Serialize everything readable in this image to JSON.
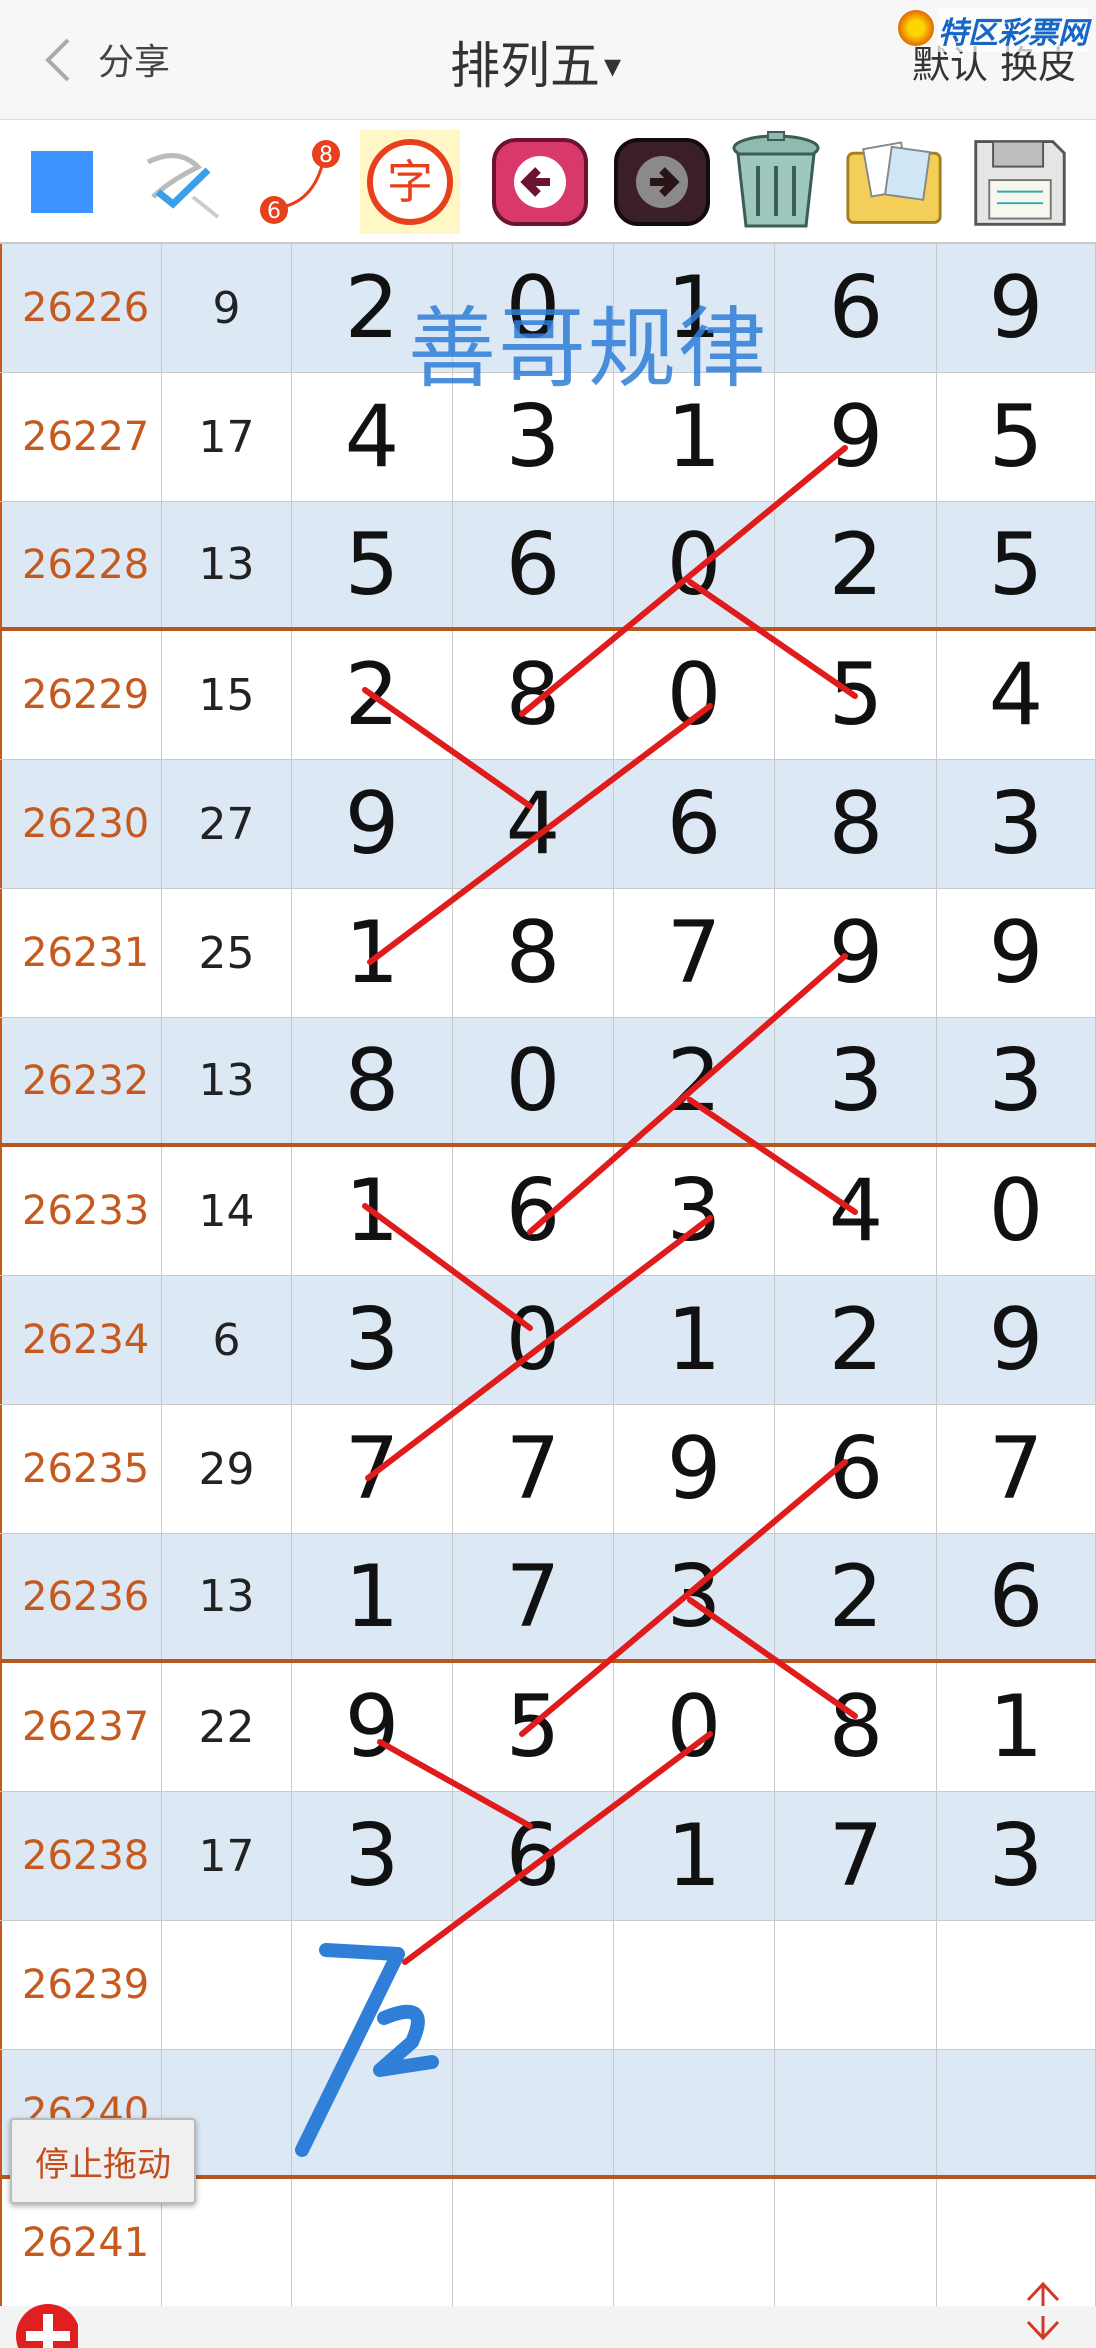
{
  "header": {
    "back_label": "分享",
    "title": "排列五",
    "title_caret": "▾",
    "right_label": "默认 换皮",
    "logo_text": "特区彩票网"
  },
  "toolbar": {
    "tools": [
      "color-square",
      "pen-check",
      "counter-6-8",
      "char-tool",
      "undo",
      "redo",
      "trash",
      "photos",
      "save"
    ],
    "char_label": "字",
    "counter_top": "8",
    "counter_bottom": "6",
    "accent": "#3d93ff"
  },
  "watermark": "善哥规律",
  "rows": [
    {
      "id": "26226",
      "sum": "9",
      "d": [
        "2",
        "0",
        "1",
        "6",
        "9"
      ]
    },
    {
      "id": "26227",
      "sum": "17",
      "d": [
        "4",
        "3",
        "1",
        "9",
        "5"
      ]
    },
    {
      "id": "26228",
      "sum": "13",
      "d": [
        "5",
        "6",
        "0",
        "2",
        "5"
      ]
    },
    {
      "id": "26229",
      "sum": "15",
      "d": [
        "2",
        "8",
        "0",
        "5",
        "4"
      ]
    },
    {
      "id": "26230",
      "sum": "27",
      "d": [
        "9",
        "4",
        "6",
        "8",
        "3"
      ]
    },
    {
      "id": "26231",
      "sum": "25",
      "d": [
        "1",
        "8",
        "7",
        "9",
        "9"
      ]
    },
    {
      "id": "26232",
      "sum": "13",
      "d": [
        "8",
        "0",
        "2",
        "3",
        "3"
      ]
    },
    {
      "id": "26233",
      "sum": "14",
      "d": [
        "1",
        "6",
        "3",
        "4",
        "0"
      ]
    },
    {
      "id": "26234",
      "sum": "6",
      "d": [
        "3",
        "0",
        "1",
        "2",
        "9"
      ]
    },
    {
      "id": "26235",
      "sum": "29",
      "d": [
        "7",
        "7",
        "9",
        "6",
        "7"
      ]
    },
    {
      "id": "26236",
      "sum": "13",
      "d": [
        "1",
        "7",
        "3",
        "2",
        "6"
      ]
    },
    {
      "id": "26237",
      "sum": "22",
      "d": [
        "9",
        "5",
        "0",
        "8",
        "1"
      ]
    },
    {
      "id": "26238",
      "sum": "17",
      "d": [
        "3",
        "6",
        "1",
        "7",
        "3"
      ]
    },
    {
      "id": "26239",
      "sum": "",
      "d": [
        "",
        "",
        "",
        "",
        ""
      ]
    },
    {
      "id": "26240",
      "sum": "",
      "d": [
        "",
        "",
        "",
        "",
        ""
      ]
    },
    {
      "id": "26241",
      "sum": "",
      "d": [
        "",
        "",
        "",
        "",
        ""
      ]
    }
  ],
  "handwriting": "72",
  "stop_drag_label": "停止拖动",
  "colors": {
    "id_text": "#c65a1e",
    "alt_row": "#dce9f5",
    "separator": "#b8571d",
    "ink": "#e01b1b",
    "blue_ink": "#2f7ed8"
  }
}
